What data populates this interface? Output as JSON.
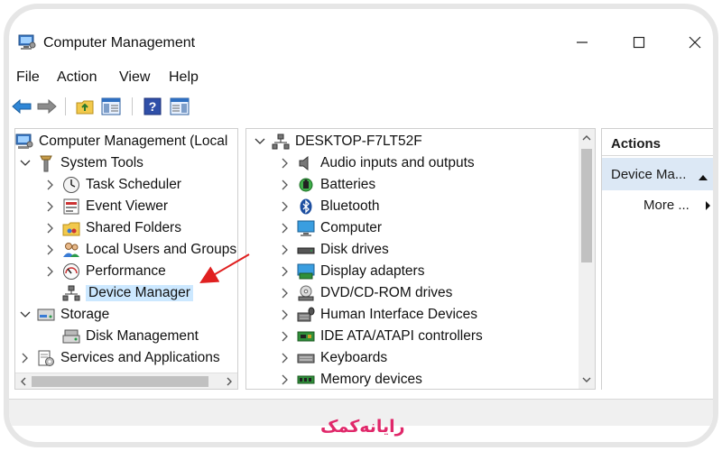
{
  "window": {
    "title": "Computer Management"
  },
  "menu": [
    "File",
    "Action",
    "View",
    "Help"
  ],
  "toolbar": {
    "icons": [
      "back-arrow-icon",
      "forward-arrow-icon",
      "up-folder-icon",
      "show-hide-console-tree-icon",
      "help-icon",
      "show-hide-action-pane-icon"
    ]
  },
  "left_tree": {
    "root": "Computer Management (Local",
    "items": [
      {
        "label": "System Tools",
        "level": 1,
        "expander": "expanded",
        "icon": "tools-icon"
      },
      {
        "label": "Task Scheduler",
        "level": 2,
        "expander": "collapsed",
        "icon": "clock-icon"
      },
      {
        "label": "Event Viewer",
        "level": 2,
        "expander": "collapsed",
        "icon": "event-viewer-icon"
      },
      {
        "label": "Shared Folders",
        "level": 2,
        "expander": "collapsed",
        "icon": "shared-folders-icon"
      },
      {
        "label": "Local Users and Groups",
        "level": 2,
        "expander": "collapsed",
        "icon": "users-icon"
      },
      {
        "label": "Performance",
        "level": 2,
        "expander": "collapsed",
        "icon": "performance-icon"
      },
      {
        "label": "Device Manager",
        "level": 2,
        "expander": "none",
        "icon": "device-manager-icon",
        "selected": true
      },
      {
        "label": "Storage",
        "level": 1,
        "expander": "expanded",
        "icon": "storage-icon"
      },
      {
        "label": "Disk Management",
        "level": 2,
        "expander": "none",
        "icon": "disk-management-icon"
      },
      {
        "label": "Services and Applications",
        "level": 1,
        "expander": "collapsed",
        "icon": "services-icon"
      }
    ]
  },
  "device_tree": {
    "root": "DESKTOP-F7LT52F",
    "items": [
      {
        "label": "Audio inputs and outputs",
        "icon": "speaker-icon"
      },
      {
        "label": "Batteries",
        "icon": "battery-icon"
      },
      {
        "label": "Bluetooth",
        "icon": "bluetooth-icon"
      },
      {
        "label": "Computer",
        "icon": "monitor-icon"
      },
      {
        "label": "Disk drives",
        "icon": "disk-drive-icon"
      },
      {
        "label": "Display adapters",
        "icon": "display-adapter-icon"
      },
      {
        "label": "DVD/CD-ROM drives",
        "icon": "dvd-icon"
      },
      {
        "label": "Human Interface Devices",
        "icon": "hid-icon"
      },
      {
        "label": "IDE ATA/ATAPI controllers",
        "icon": "ide-controller-icon"
      },
      {
        "label": "Keyboards",
        "icon": "keyboard-icon"
      },
      {
        "label": "Memory devices",
        "icon": "memory-icon"
      }
    ]
  },
  "actions": {
    "header": "Actions",
    "group": "Device Ma...",
    "more": "More ..."
  },
  "brand": {
    "text": "رایانه‌کمک"
  },
  "colors": {
    "selection": "#cce8ff",
    "actions_group_bg": "#dce8f5",
    "annotation_arrow": "#e02020",
    "brand": "#e0286a"
  }
}
